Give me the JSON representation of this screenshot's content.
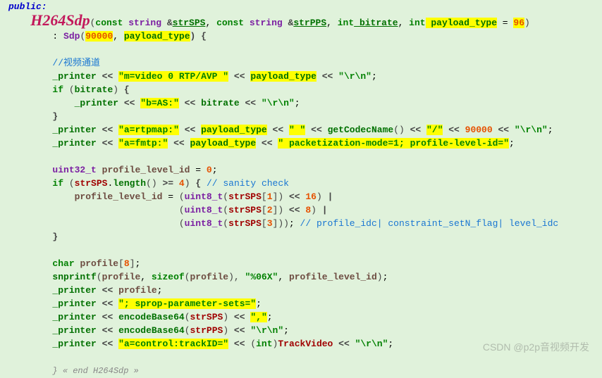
{
  "lines": {
    "public": "public:",
    "h264": "H264Sdp",
    "sig_open": "(",
    "sig_const1": "const",
    "sig_string1": " string ",
    "sig_amp1": "&",
    "sig_strsps": "strSPS",
    "sig_comma1": ", ",
    "sig_const2": "const",
    "sig_string2": " string ",
    "sig_amp2": "&",
    "sig_strpps": "strPPS",
    "sig_comma2": ", ",
    "sig_int1": "int",
    "sig_bitrate": " bitrate",
    "sig_comma3": ", ",
    "sig_int2": "int",
    "sig_ptype": " payload_type",
    "sig_eq": " = ",
    "sig_96": "96",
    "sig_close": ")",
    "init_colon": ": ",
    "init_sdp": "Sdp",
    "init_open": "(",
    "init_90000": "90000",
    "init_comma": ", ",
    "init_ptype": "payload_type",
    "init_close": ") {",
    "c_video": "//视频通道",
    "printer": "_printer",
    "lshift": " << ",
    "s_mvideo": "\"m=video 0 RTP/AVP \"",
    "s_rn": "\"\\r\\n\"",
    "semi": ";",
    "kw_if": "if",
    "id_bitrate": "bitrate",
    "s_bas": "\"b=AS:\"",
    "close_brace": "}",
    "s_rtpmap": "\"a=rtpmap:\"",
    "s_spc": "\" \"",
    "getCodecName": "getCodecName",
    "s_slash": "\"/\"",
    "n_90000": "90000",
    "s_fmtp": "\"a=fmtp:\"",
    "s_packet": "\" packetization-mode=1; profile-level-id=\"",
    "uint32": "uint32_t",
    "pli": "profile_level_id",
    "eq0": " = ",
    "n0": "0",
    "strsps_id": "strSPS",
    "length": "length",
    "ge": " >= ",
    "n4": "4",
    "c_sanity": "// sanity check",
    "uint8": "uint8_t",
    "idx1": "1",
    "idx2": "2",
    "idx3": "3",
    "n16": "16",
    "n8": "8",
    "pipe": " |",
    "c_profile": "// profile_idc| constraint_setN_flag| level_idc",
    "kw_char": "char",
    "profile": "profile",
    "idx8": "8",
    "snprintf": "snprintf",
    "sizeof": "sizeof",
    "s_06x": "\"%06X\"",
    "s_sprop": "\"; sprop-parameter-sets=\"",
    "encodeBase64": "encodeBase64",
    "strpps_id": "strPPS",
    "s_comma": "\",\"",
    "s_control": "\"a=control:trackID=\"",
    "kw_int_c": "int",
    "trackvideo": "TrackVideo",
    "end": "} « end H264Sdp »"
  },
  "watermark": "CSDN @p2p音视频开发"
}
